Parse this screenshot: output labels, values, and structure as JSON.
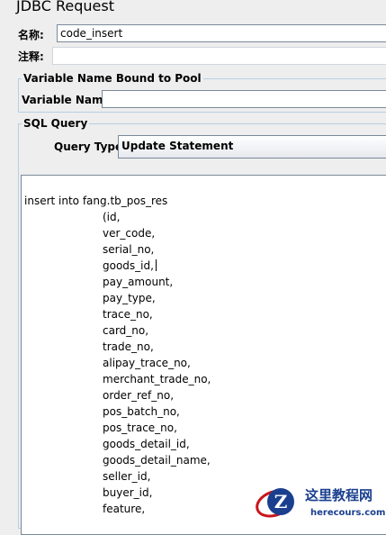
{
  "title": "JDBC Request",
  "name": {
    "label": "名称:",
    "value": "code_insert"
  },
  "comment": {
    "label": "注释:",
    "value": ""
  },
  "variable_panel": {
    "legend": "Variable Name Bound to Pool",
    "field_label": "Variable Name:",
    "field_value": ""
  },
  "sql_panel": {
    "legend": "SQL Query",
    "query_type_label": "Query Type:",
    "query_type_value": "Update Statement"
  },
  "sql": {
    "first_line": "insert into fang.tb_pos_res",
    "columns": [
      "(id,",
      "ver_code,",
      "serial_no,",
      "goods_id,",
      "pay_amount,",
      "pay_type,",
      "trace_no,",
      "card_no,",
      "trade_no,",
      "alipay_trace_no,",
      "merchant_trade_no,",
      "order_ref_no,",
      "pos_batch_no,",
      "pos_trace_no,",
      "goods_detail_id,",
      "goods_detail_name,",
      "seller_id,",
      "buyer_id,",
      "feature,"
    ],
    "cursor_after_index": 3
  },
  "watermark": {
    "logo_letter": "Z",
    "cn_text": "这里教程网",
    "url": "herecours.com",
    "colors": {
      "red": "#c8161d",
      "blue": "#1a3f8f"
    }
  }
}
